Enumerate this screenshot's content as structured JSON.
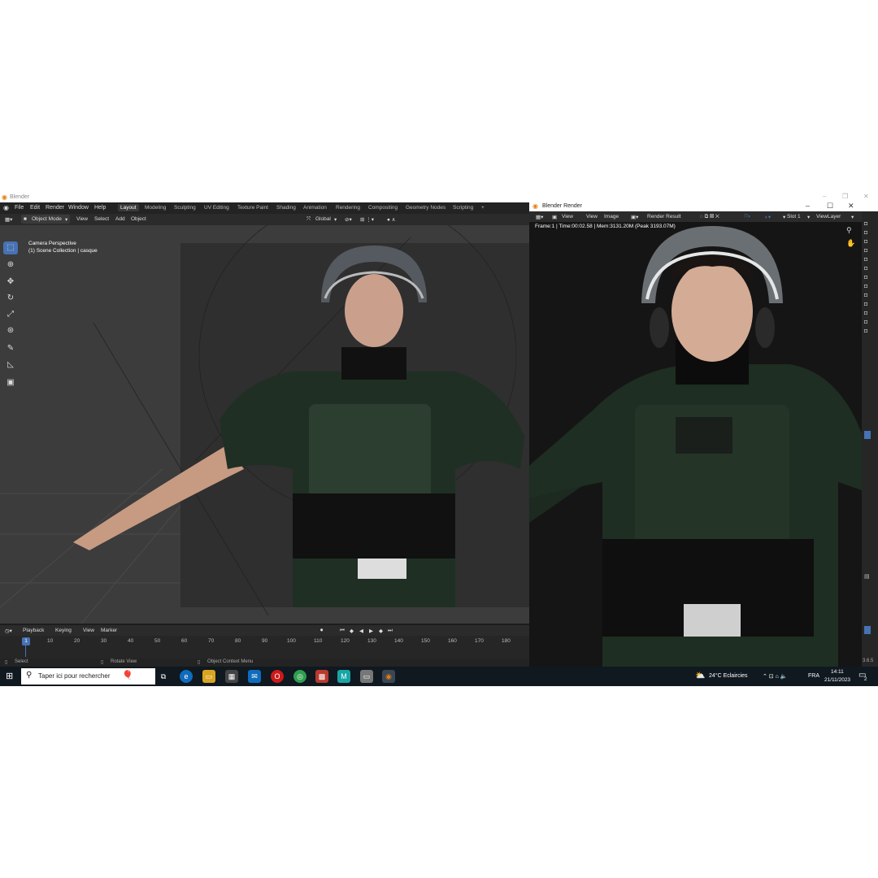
{
  "app": {
    "title": "Blender"
  },
  "menu": [
    "File",
    "Edit",
    "Render",
    "Window",
    "Help"
  ],
  "workspaces": [
    "Layout",
    "Modeling",
    "Sculpting",
    "UV Editing",
    "Texture Paint",
    "Shading",
    "Animation",
    "Rendering",
    "Compositing",
    "Geometry Nodes",
    "Scripting"
  ],
  "active_workspace": "Layout",
  "viewport_header": {
    "mode": "Object Mode",
    "items": [
      "View",
      "Select",
      "Add",
      "Object"
    ],
    "orientation": "Global"
  },
  "viewport_overlay": {
    "line1": "Camera Perspective",
    "line2": "(1) Scene Collection | casque"
  },
  "timeline": {
    "items": [
      "Playback",
      "Keying",
      "View",
      "Marker"
    ],
    "current_frame": "1",
    "ticks": [
      "10",
      "20",
      "30",
      "40",
      "50",
      "60",
      "70",
      "80",
      "90",
      "100",
      "110",
      "120",
      "130",
      "140",
      "150",
      "160",
      "170",
      "180"
    ]
  },
  "statusbar": {
    "select": "Select",
    "rotate": "Rotate View",
    "context": "Object Context Menu"
  },
  "render_window": {
    "title": "Blender Render",
    "header": [
      "View",
      "View",
      "Image"
    ],
    "image_name": "Render Result",
    "slot": "Slot 1",
    "view_layer": "ViewLayer",
    "info": "Frame:1 | Time:00:02.58 | Mem:3131.20M (Peak 3193.07M)",
    "version": "3.6.5"
  },
  "taskbar": {
    "search_placeholder": "Taper ici pour rechercher",
    "weather": "24°C  Eclaircies",
    "lang": "FRA",
    "time": "14:11",
    "date": "21/11/2023",
    "notif_count": "2"
  },
  "colors": {
    "accent": "#4772b3",
    "bg_dark": "#1d1d1d",
    "taskbar": "#101820"
  }
}
